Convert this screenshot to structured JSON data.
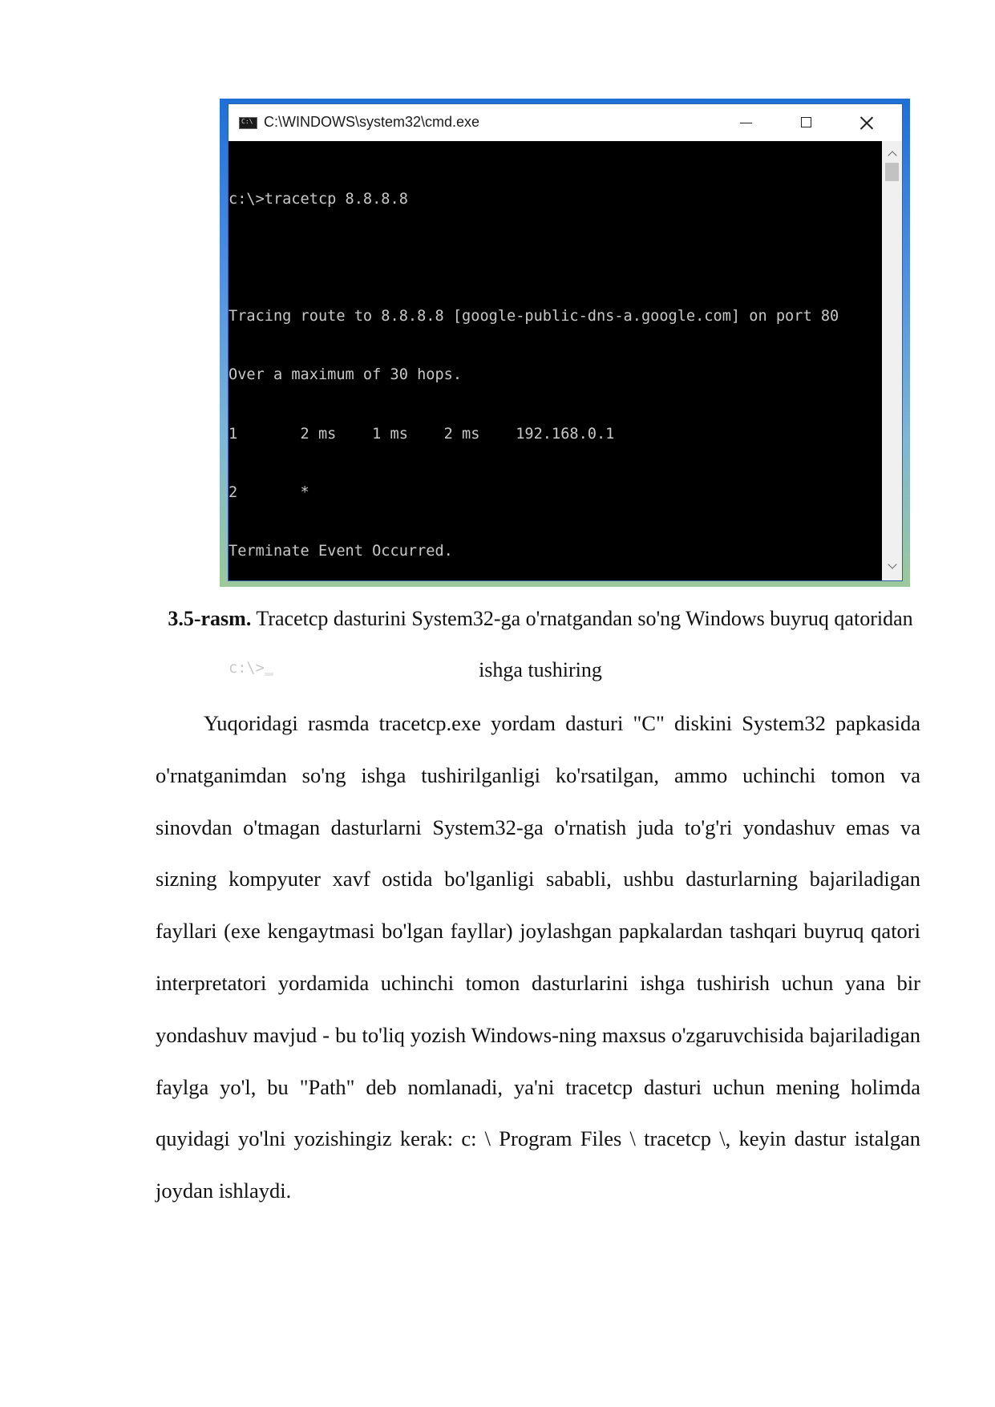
{
  "window": {
    "title": "C:\\WINDOWS\\system32\\cmd.exe",
    "buttons": [
      "minimize",
      "maximize",
      "close"
    ]
  },
  "console": {
    "lines": [
      "c:\\>tracetcp 8.8.8.8",
      "",
      "Tracing route to 8.8.8.8 [google-public-dns-a.google.com] on port 80",
      "Over a maximum of 30 hops.",
      "1       2 ms    1 ms    2 ms    192.168.0.1",
      "2       *",
      "Terminate Event Occurred.",
      "",
      "c:\\>"
    ]
  },
  "caption": {
    "label": "3.5-rasm.",
    "text": " Tracetcp dasturini System32-ga o'rnatgandan so'ng Windows buyruq qatoridan ishga tushiring"
  },
  "paragraph": "Yuqoridagi rasmda tracetcp.exe yordam dasturi \"C\" diskini System32 papkasida o'rnatganimdan so'ng ishga tushirilganligi ko'rsatilgan, ammo uchinchi tomon va sinovdan o'tmagan dasturlarni System32-ga o'rnatish juda to'g'ri yondashuv emas va sizning kompyuter xavf ostida bo'lganligi sababli, ushbu dasturlarning bajariladigan fayllari (exe kengaytmasi bo'lgan fayllar) joylashgan papkalardan tashqari buyruq qatori interpretatori  yordamida uchinchi tomon dasturlarini ishga tushirish uchun yana bir yondashuv mavjud - bu to'liq yozish Windows-ning maxsus o'zgaruvchisida bajariladigan faylga yo'l, bu \"Path\" deb nomlanadi, ya'ni tracetcp dasturi uchun mening holimda quyidagi yo'lni yozishingiz kerak: c: \\ Program Files \\ tracetcp \\, keyin dastur istalgan joydan ishlaydi."
}
